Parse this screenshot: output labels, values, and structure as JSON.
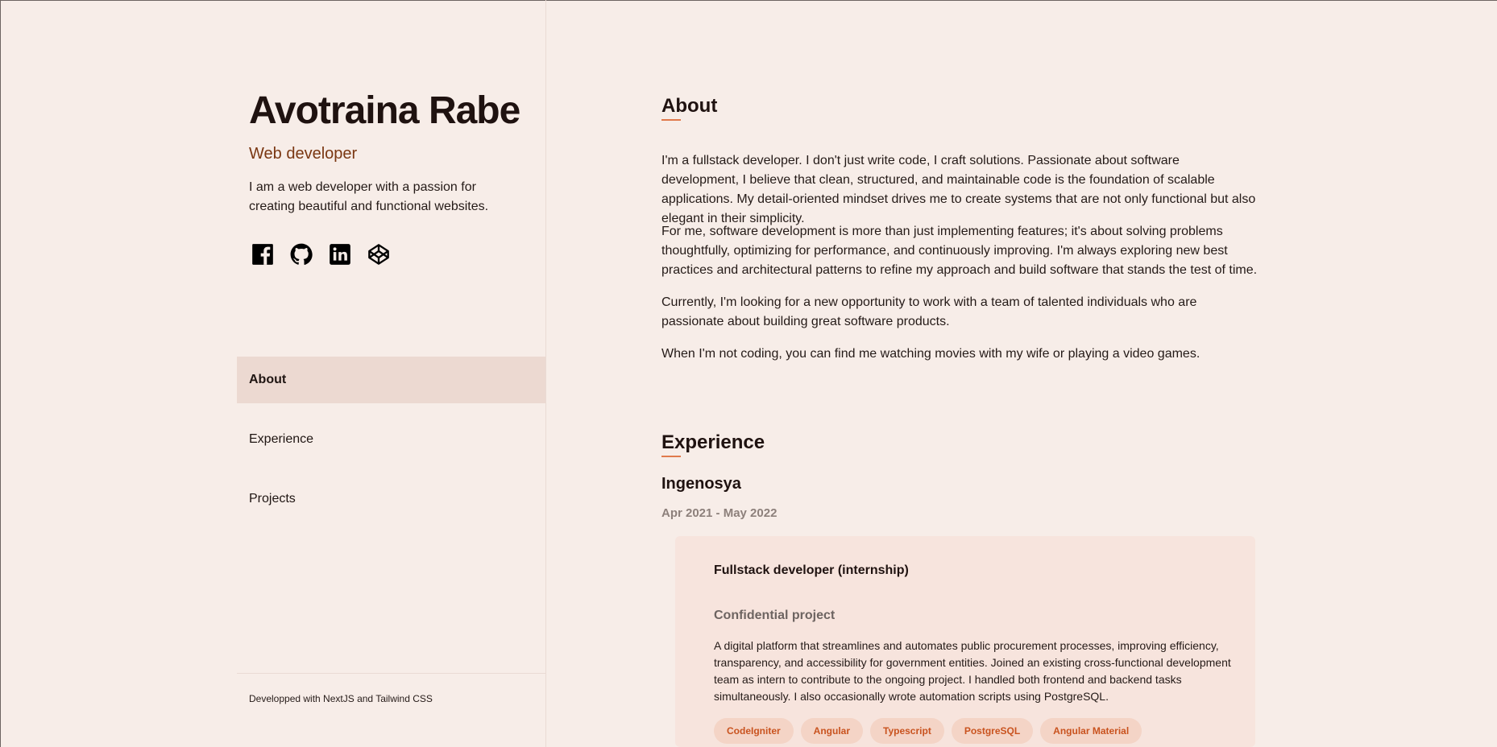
{
  "profile": {
    "name": "Avotraina Rabe",
    "role": "Web developer",
    "bio": "I am a web developer with a passion for creating beautiful and functional websites."
  },
  "socials": [
    {
      "icon": "facebook-icon"
    },
    {
      "icon": "github-icon"
    },
    {
      "icon": "linkedin-icon"
    },
    {
      "icon": "codepen-icon"
    }
  ],
  "nav": {
    "items": [
      {
        "label": "About",
        "active": true
      },
      {
        "label": "Experience",
        "active": false
      },
      {
        "label": "Projects",
        "active": false
      }
    ]
  },
  "footer": {
    "text": "Developped with NextJS and Tailwind CSS"
  },
  "about": {
    "title": "About",
    "paragraphs": [
      "I'm a fullstack developer. I don't just write code, I craft solutions. Passionate about software development, I believe that clean, structured, and maintainable code is the foundation of scalable applications. My detail-oriented mindset drives me to create systems that are not only functional but also elegant in their simplicity.",
      "For me, software development is more than just implementing features; it's about solving problems thoughtfully, optimizing for performance, and continuously improving. I'm always exploring new best practices and architectural patterns to refine my approach and build software that stands the test of time.",
      "Currently, I'm looking for a new opportunity to work with a team of talented individuals who are passionate about building great software products.",
      "When I'm not coding, you can find me watching movies with my wife or playing a video games."
    ]
  },
  "experience": {
    "title": "Experience",
    "company": "Ingenosya",
    "period": "Apr 2021 - May 2022",
    "position": "Fullstack developer (internship)",
    "project": "Confidential project",
    "description": "A digital platform that streamlines and automates public procurement processes, improving efficiency, transparency, and accessibility for government entities. Joined an existing cross-functional development team as intern to contribute to the ongoing project. I handled both frontend and backend tasks simultaneously. I also occasionally wrote automation scripts using PostgreSQL.",
    "tags": [
      "CodeIgniter",
      "Angular",
      "Typescript",
      "PostgreSQL",
      "Angular Material"
    ]
  },
  "colors": {
    "background": "#f7ede8",
    "accent": "#e07a4c",
    "role_text": "#7a3712",
    "active_nav": "#ecd9d1",
    "tag_bg": "#f4d4c6",
    "tag_text": "#c9531f"
  }
}
